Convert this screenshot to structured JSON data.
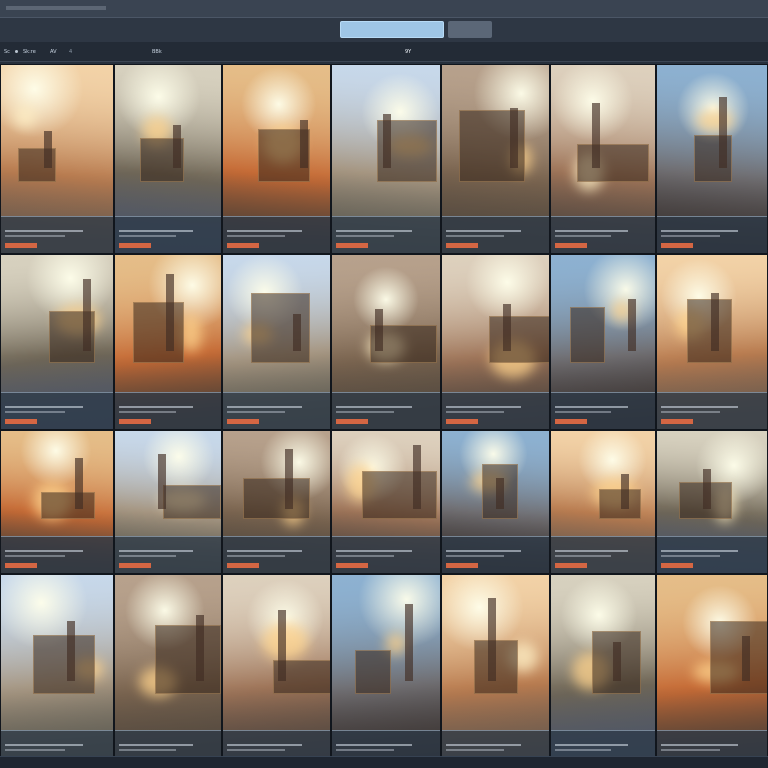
{
  "toolbar": {
    "search_text": "",
    "search_placeholder": "",
    "go_label": ""
  },
  "filters": [
    {
      "label": "Sc"
    },
    {
      "label": "Sk:re"
    },
    {
      "label": "AV"
    },
    {
      "label": "4"
    },
    {
      "label": "BBk"
    },
    {
      "label": ""
    },
    {
      "label": "9Y"
    }
  ],
  "tiles": [
    {
      "caption": "",
      "tag": ""
    },
    {
      "caption": "",
      "tag": ""
    },
    {
      "caption": "",
      "tag": ""
    },
    {
      "caption": "",
      "tag": ""
    },
    {
      "caption": "",
      "tag": ""
    },
    {
      "caption": "",
      "tag": ""
    },
    {
      "caption": "",
      "tag": ""
    },
    {
      "caption": "",
      "tag": ""
    },
    {
      "caption": "",
      "tag": ""
    },
    {
      "caption": "",
      "tag": ""
    },
    {
      "caption": "",
      "tag": ""
    },
    {
      "caption": "",
      "tag": ""
    },
    {
      "caption": "",
      "tag": ""
    },
    {
      "caption": "",
      "tag": ""
    },
    {
      "caption": "",
      "tag": ""
    },
    {
      "caption": "",
      "tag": ""
    },
    {
      "caption": "",
      "tag": ""
    },
    {
      "caption": "",
      "tag": ""
    },
    {
      "caption": "",
      "tag": ""
    },
    {
      "caption": "",
      "tag": ""
    },
    {
      "caption": "",
      "tag": ""
    },
    {
      "caption": "",
      "tag": ""
    },
    {
      "caption": "",
      "tag": ""
    },
    {
      "caption": "",
      "tag": ""
    },
    {
      "caption": "",
      "tag": ""
    },
    {
      "caption": "",
      "tag": ""
    },
    {
      "caption": "",
      "tag": ""
    },
    {
      "caption": "",
      "tag": ""
    }
  ]
}
